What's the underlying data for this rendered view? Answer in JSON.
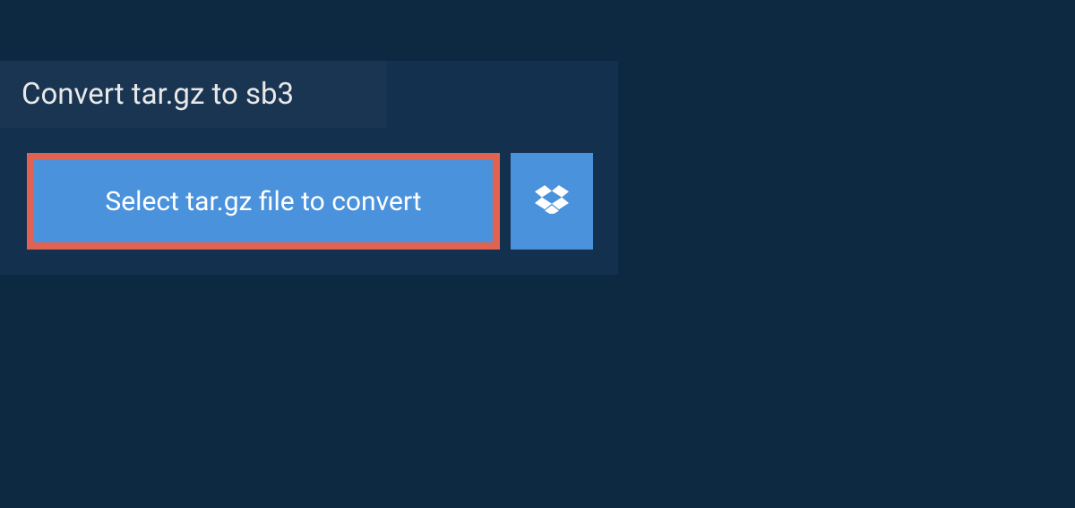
{
  "header": {
    "title": "Convert tar.gz to sb3"
  },
  "buttons": {
    "select_file_label": "Select tar.gz file to convert"
  },
  "colors": {
    "page_bg": "#0d2841",
    "panel_bg": "#13314f",
    "tab_bg": "#1a3552",
    "button_bg": "#4b92dd",
    "highlight_border": "#e06352",
    "text_light": "#e8e8e8",
    "text_white": "#ffffff"
  }
}
